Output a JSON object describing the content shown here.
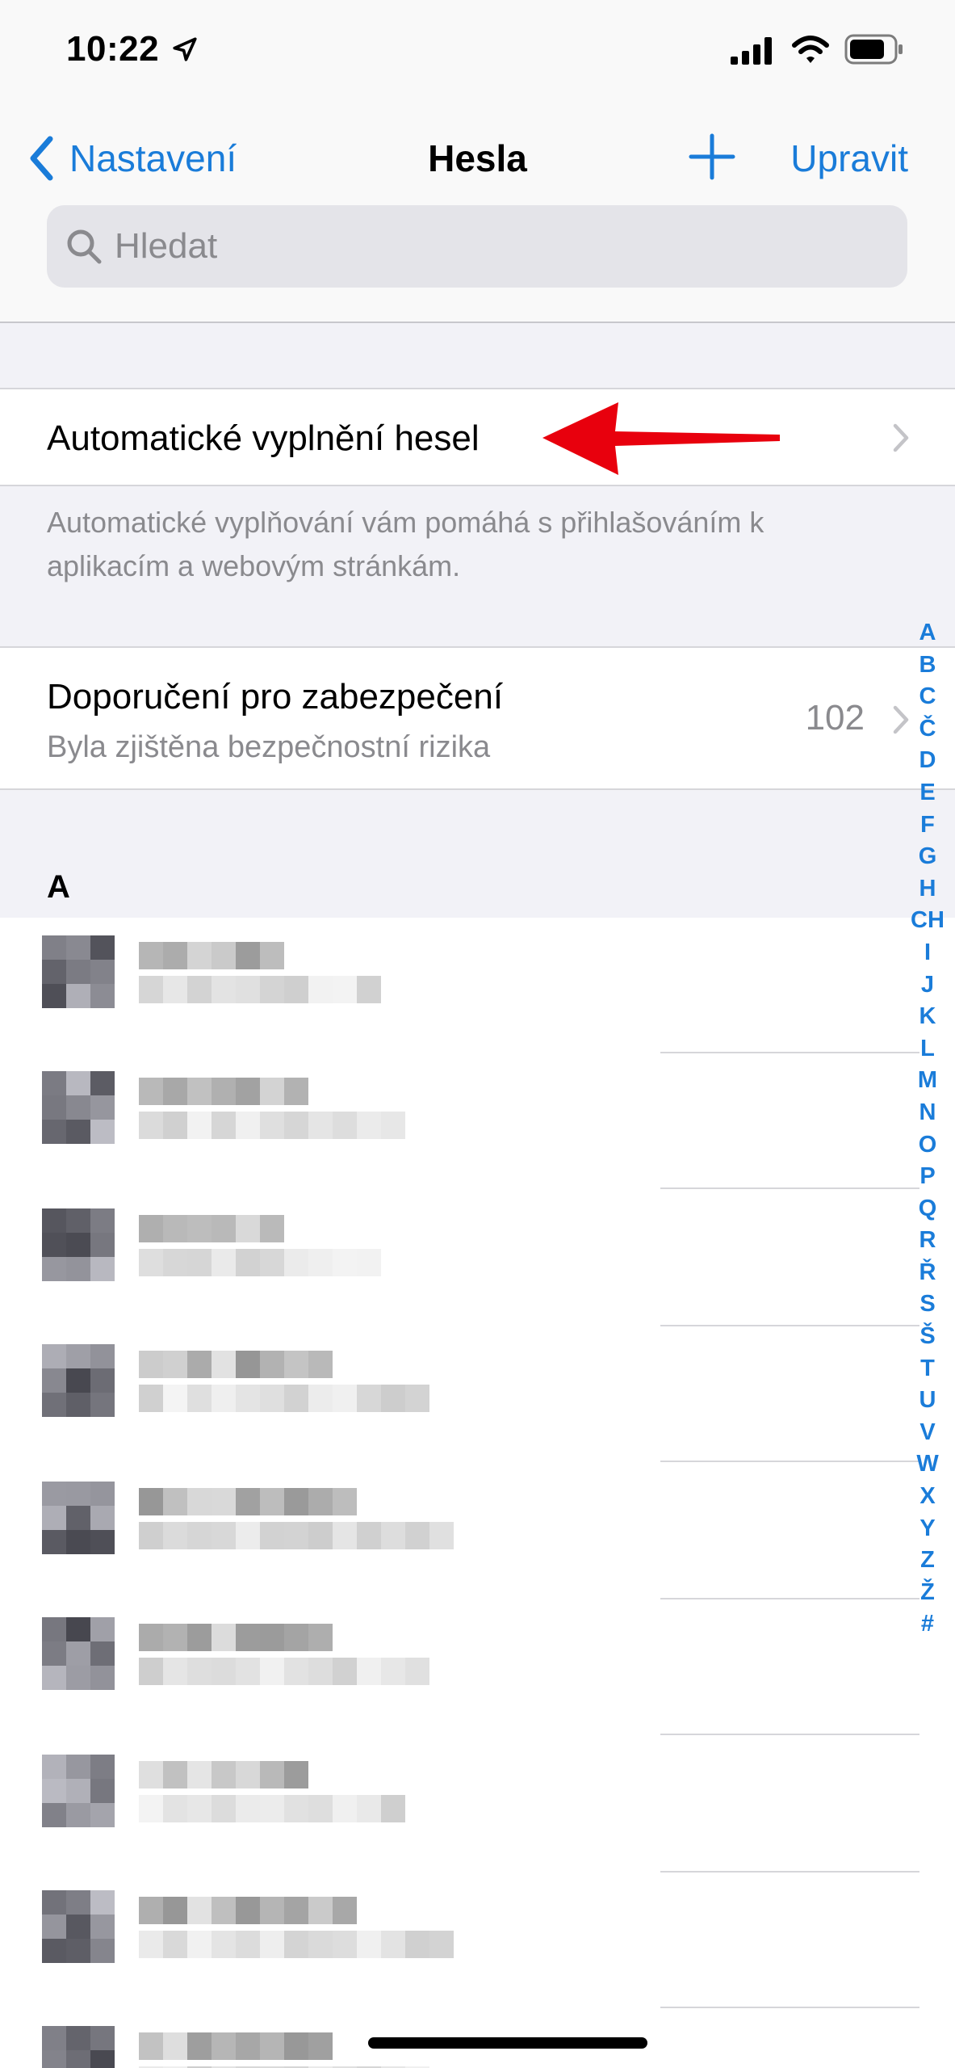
{
  "status_bar": {
    "time": "10:22"
  },
  "nav": {
    "back_label": "Nastavení",
    "title": "Hesla",
    "edit_label": "Upravit",
    "search_placeholder": "Hledat"
  },
  "autofill": {
    "title": "Automatické vyplnění hesel",
    "footer": "Automatické vyplňování vám pomáhá s přihlašováním k aplikacím a webovým stránkám."
  },
  "security": {
    "title": "Doporučení pro zabezpečení",
    "subtitle": "Byla zjištěna bezpečnostní rizika",
    "count": "102"
  },
  "section_header": "A",
  "index_letters": [
    "A",
    "B",
    "C",
    "Č",
    "D",
    "E",
    "F",
    "G",
    "H",
    "CH",
    "I",
    "J",
    "K",
    "L",
    "M",
    "N",
    "O",
    "P",
    "Q",
    "R",
    "Ř",
    "S",
    "Š",
    "T",
    "U",
    "V",
    "W",
    "X",
    "Y",
    "Z",
    "Ž",
    "#"
  ],
  "colors": {
    "accent": "#1a7cd9",
    "annotation_arrow": "#e8000d",
    "secondary_text": "#8a8a8e",
    "grouped_background": "#f2f2f7"
  },
  "icons": [
    "location-arrow-icon",
    "signal-icon",
    "wifi-icon",
    "battery-icon",
    "chevron-left-icon",
    "plus-icon",
    "search-icon",
    "chevron-right-icon"
  ]
}
